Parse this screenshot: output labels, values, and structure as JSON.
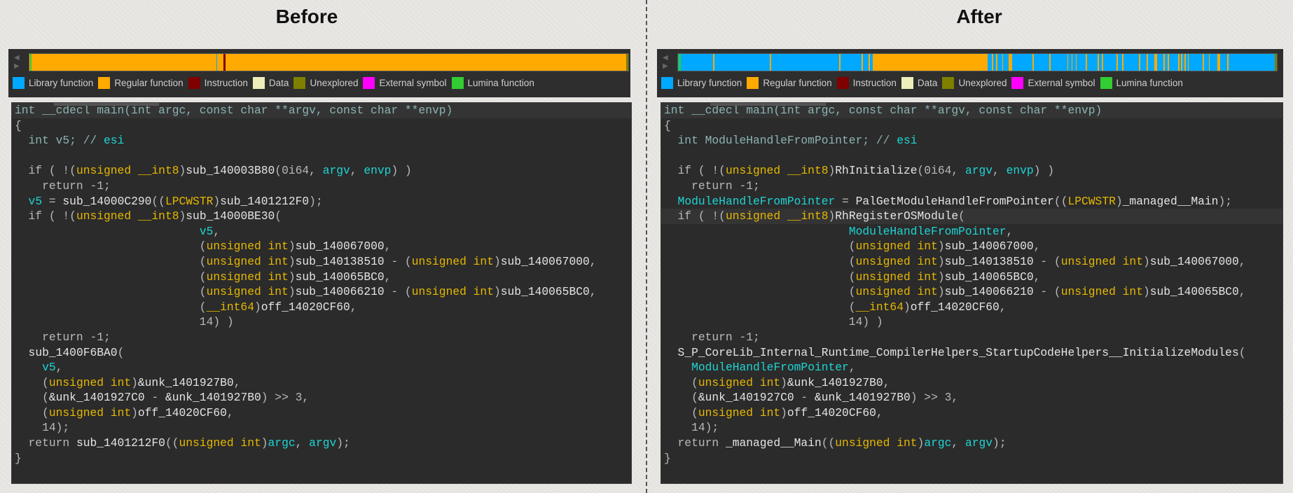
{
  "legend": [
    {
      "label": "Library function",
      "color": "#00a8ff"
    },
    {
      "label": "Regular function",
      "color": "#ffaa00"
    },
    {
      "label": "Instruction",
      "color": "#800000"
    },
    {
      "label": "Data",
      "color": "#eeeebb"
    },
    {
      "label": "Unexplored",
      "color": "#7f7f00"
    },
    {
      "label": "External symbol",
      "color": "#ff00ff"
    },
    {
      "label": "Lumina function",
      "color": "#33cc33"
    }
  ],
  "panels": [
    {
      "title": "Before",
      "bar_base": "#ffaa00",
      "bar_segments": [
        {
          "start": 0.001,
          "width": 0.003,
          "color": "#33cc33"
        },
        {
          "start": 0.312,
          "width": 0.002,
          "color": "#00a8ff"
        },
        {
          "start": 0.324,
          "width": 0.003,
          "color": "#800000"
        },
        {
          "start": 0.997,
          "width": 0.003,
          "color": "#7f7f00"
        }
      ],
      "highlighted_lines": [
        0
      ],
      "code": [
        [
          [
            "s",
            "int __cdecl main(int argc, const char **argv, const char **envp)"
          ]
        ],
        [
          [
            "k",
            "{"
          ]
        ],
        [
          [
            "s",
            "  int v5; // "
          ],
          [
            "v",
            "esi"
          ]
        ],
        [],
        [
          [
            "k",
            "  if ( !("
          ],
          [
            "t",
            "unsigned __int8"
          ],
          [
            "k",
            ")"
          ],
          [
            "i",
            "sub_140003B80"
          ],
          [
            "k",
            "(0i64, "
          ],
          [
            "v",
            "argv"
          ],
          [
            "k",
            ", "
          ],
          [
            "v",
            "envp"
          ],
          [
            "k",
            ") )"
          ]
        ],
        [
          [
            "k",
            "    return -1;"
          ]
        ],
        [
          [
            "k",
            "  "
          ],
          [
            "v",
            "v5"
          ],
          [
            "k",
            " = "
          ],
          [
            "i",
            "sub_14000C290"
          ],
          [
            "k",
            "(("
          ],
          [
            "t",
            "LPCWSTR"
          ],
          [
            "k",
            ")"
          ],
          [
            "i",
            "sub_1401212F0"
          ],
          [
            "k",
            ");"
          ]
        ],
        [
          [
            "k",
            "  if ( !("
          ],
          [
            "t",
            "unsigned __int8"
          ],
          [
            "k",
            ")"
          ],
          [
            "i",
            "sub_14000BE30"
          ],
          [
            "k",
            "("
          ]
        ],
        [
          [
            "k",
            "                           "
          ],
          [
            "v",
            "v5"
          ],
          [
            "k",
            ","
          ]
        ],
        [
          [
            "k",
            "                           ("
          ],
          [
            "t",
            "unsigned int"
          ],
          [
            "k",
            ")"
          ],
          [
            "i",
            "sub_140067000"
          ],
          [
            "k",
            ","
          ]
        ],
        [
          [
            "k",
            "                           ("
          ],
          [
            "t",
            "unsigned int"
          ],
          [
            "k",
            ")"
          ],
          [
            "i",
            "sub_140138510"
          ],
          [
            "k",
            " - ("
          ],
          [
            "t",
            "unsigned int"
          ],
          [
            "k",
            ")"
          ],
          [
            "i",
            "sub_140067000"
          ],
          [
            "k",
            ","
          ]
        ],
        [
          [
            "k",
            "                           ("
          ],
          [
            "t",
            "unsigned int"
          ],
          [
            "k",
            ")"
          ],
          [
            "i",
            "sub_140065BC0"
          ],
          [
            "k",
            ","
          ]
        ],
        [
          [
            "k",
            "                           ("
          ],
          [
            "t",
            "unsigned int"
          ],
          [
            "k",
            ")"
          ],
          [
            "i",
            "sub_140066210"
          ],
          [
            "k",
            " - ("
          ],
          [
            "t",
            "unsigned int"
          ],
          [
            "k",
            ")"
          ],
          [
            "i",
            "sub_140065BC0"
          ],
          [
            "k",
            ","
          ]
        ],
        [
          [
            "k",
            "                           ("
          ],
          [
            "t",
            "__int64"
          ],
          [
            "k",
            ")"
          ],
          [
            "i",
            "off_14020CF60"
          ],
          [
            "k",
            ","
          ]
        ],
        [
          [
            "k",
            "                           14) )"
          ]
        ],
        [
          [
            "k",
            "    return -1;"
          ]
        ],
        [
          [
            "k",
            "  "
          ],
          [
            "i",
            "sub_1400F6BA0"
          ],
          [
            "k",
            "("
          ]
        ],
        [
          [
            "k",
            "    "
          ],
          [
            "v",
            "v5"
          ],
          [
            "k",
            ","
          ]
        ],
        [
          [
            "k",
            "    ("
          ],
          [
            "t",
            "unsigned int"
          ],
          [
            "k",
            ")"
          ],
          [
            "i",
            "&unk_1401927B0"
          ],
          [
            "k",
            ","
          ]
        ],
        [
          [
            "k",
            "    ("
          ],
          [
            "i",
            "&unk_1401927C0"
          ],
          [
            "k",
            " - "
          ],
          [
            "i",
            "&unk_1401927B0"
          ],
          [
            "k",
            ") >> 3,"
          ]
        ],
        [
          [
            "k",
            "    ("
          ],
          [
            "t",
            "unsigned int"
          ],
          [
            "k",
            ")"
          ],
          [
            "i",
            "off_14020CF60"
          ],
          [
            "k",
            ","
          ]
        ],
        [
          [
            "k",
            "    14);"
          ]
        ],
        [
          [
            "k",
            "  return "
          ],
          [
            "i",
            "sub_1401212F0"
          ],
          [
            "k",
            "(("
          ],
          [
            "t",
            "unsigned int"
          ],
          [
            "k",
            ")"
          ],
          [
            "v",
            "argc"
          ],
          [
            "k",
            ", "
          ],
          [
            "v",
            "argv"
          ],
          [
            "k",
            ");"
          ]
        ],
        [
          [
            "k",
            "}"
          ]
        ]
      ]
    },
    {
      "title": "After",
      "bar_base": "#00a8ff",
      "bar_segments": [
        {
          "start": 0.001,
          "width": 0.004,
          "color": "#33cc33"
        },
        {
          "start": 0.325,
          "width": 0.192,
          "color": "#ffaa00"
        },
        {
          "start": 0.059,
          "width": 0.002,
          "color": "#ffaa00"
        },
        {
          "start": 0.153,
          "width": 0.002,
          "color": "#ffaa00"
        },
        {
          "start": 0.269,
          "width": 0.002,
          "color": "#ffaa00"
        },
        {
          "start": 0.307,
          "width": 0.002,
          "color": "#ffaa00"
        },
        {
          "start": 0.318,
          "width": 0.002,
          "color": "#ffaa00"
        },
        {
          "start": 0.524,
          "width": 0.002,
          "color": "#ffaa00"
        },
        {
          "start": 0.531,
          "width": 0.002,
          "color": "#ffaa00"
        },
        {
          "start": 0.541,
          "width": 0.002,
          "color": "#ffaa00"
        },
        {
          "start": 0.552,
          "width": 0.006,
          "color": "#ffaa00"
        },
        {
          "start": 0.592,
          "width": 0.002,
          "color": "#ffaa00"
        },
        {
          "start": 0.62,
          "width": 0.002,
          "color": "#ffaa00"
        },
        {
          "start": 0.65,
          "width": 0.002,
          "color": "#ffaa00"
        },
        {
          "start": 0.657,
          "width": 0.002,
          "color": "#ffaa00"
        },
        {
          "start": 0.664,
          "width": 0.002,
          "color": "#ffaa00"
        },
        {
          "start": 0.681,
          "width": 0.002,
          "color": "#ffaa00"
        },
        {
          "start": 0.701,
          "width": 0.002,
          "color": "#ffaa00"
        },
        {
          "start": 0.708,
          "width": 0.002,
          "color": "#ffaa00"
        },
        {
          "start": 0.732,
          "width": 0.002,
          "color": "#ffaa00"
        },
        {
          "start": 0.742,
          "width": 0.002,
          "color": "#ffaa00"
        },
        {
          "start": 0.77,
          "width": 0.002,
          "color": "#ffaa00"
        },
        {
          "start": 0.783,
          "width": 0.002,
          "color": "#ffaa00"
        },
        {
          "start": 0.795,
          "width": 0.005,
          "color": "#ffaa00"
        },
        {
          "start": 0.811,
          "width": 0.002,
          "color": "#ffaa00"
        },
        {
          "start": 0.818,
          "width": 0.002,
          "color": "#ffaa00"
        },
        {
          "start": 0.835,
          "width": 0.002,
          "color": "#ffaa00"
        },
        {
          "start": 0.84,
          "width": 0.002,
          "color": "#ffaa00"
        },
        {
          "start": 0.846,
          "width": 0.002,
          "color": "#ffaa00"
        },
        {
          "start": 0.851,
          "width": 0.002,
          "color": "#ffaa00"
        },
        {
          "start": 0.876,
          "width": 0.002,
          "color": "#ffaa00"
        },
        {
          "start": 0.886,
          "width": 0.002,
          "color": "#ffaa00"
        },
        {
          "start": 0.901,
          "width": 0.004,
          "color": "#ffaa00"
        },
        {
          "start": 0.917,
          "width": 0.002,
          "color": "#ffaa00"
        },
        {
          "start": 0.997,
          "width": 0.003,
          "color": "#7f7f00"
        }
      ],
      "highlighted_lines": [
        0,
        7
      ],
      "code": [
        [
          [
            "s",
            "int __cdecl main(int argc, const char **argv, const char **envp)"
          ]
        ],
        [
          [
            "k",
            "{"
          ]
        ],
        [
          [
            "s",
            "  int ModuleHandleFromPointer; // "
          ],
          [
            "v",
            "esi"
          ]
        ],
        [],
        [
          [
            "k",
            "  if ( !("
          ],
          [
            "t",
            "unsigned __int8"
          ],
          [
            "k",
            ")"
          ],
          [
            "i",
            "RhInitialize"
          ],
          [
            "k",
            "(0i64, "
          ],
          [
            "v",
            "argv"
          ],
          [
            "k",
            ", "
          ],
          [
            "v",
            "envp"
          ],
          [
            "k",
            ") )"
          ]
        ],
        [
          [
            "k",
            "    return -1;"
          ]
        ],
        [
          [
            "k",
            "  "
          ],
          [
            "v",
            "ModuleHandleFromPointer"
          ],
          [
            "k",
            " = "
          ],
          [
            "i",
            "PalGetModuleHandleFromPointer"
          ],
          [
            "k",
            "(("
          ],
          [
            "t",
            "LPCWSTR"
          ],
          [
            "k",
            ")"
          ],
          [
            "i",
            "_managed__Main"
          ],
          [
            "k",
            ");"
          ]
        ],
        [
          [
            "k",
            "  if ( !("
          ],
          [
            "t",
            "unsigned __int8"
          ],
          [
            "k",
            ")"
          ],
          [
            "i",
            "RhRegisterOSModule"
          ],
          [
            "k",
            "("
          ]
        ],
        [
          [
            "k",
            "                           "
          ],
          [
            "v",
            "ModuleHandleFromPointer"
          ],
          [
            "k",
            ","
          ]
        ],
        [
          [
            "k",
            "                           ("
          ],
          [
            "t",
            "unsigned int"
          ],
          [
            "k",
            ")"
          ],
          [
            "i",
            "sub_140067000"
          ],
          [
            "k",
            ","
          ]
        ],
        [
          [
            "k",
            "                           ("
          ],
          [
            "t",
            "unsigned int"
          ],
          [
            "k",
            ")"
          ],
          [
            "i",
            "sub_140138510"
          ],
          [
            "k",
            " - ("
          ],
          [
            "t",
            "unsigned int"
          ],
          [
            "k",
            ")"
          ],
          [
            "i",
            "sub_140067000"
          ],
          [
            "k",
            ","
          ]
        ],
        [
          [
            "k",
            "                           ("
          ],
          [
            "t",
            "unsigned int"
          ],
          [
            "k",
            ")"
          ],
          [
            "i",
            "sub_140065BC0"
          ],
          [
            "k",
            ","
          ]
        ],
        [
          [
            "k",
            "                           ("
          ],
          [
            "t",
            "unsigned int"
          ],
          [
            "k",
            ")"
          ],
          [
            "i",
            "sub_140066210"
          ],
          [
            "k",
            " - ("
          ],
          [
            "t",
            "unsigned int"
          ],
          [
            "k",
            ")"
          ],
          [
            "i",
            "sub_140065BC0"
          ],
          [
            "k",
            ","
          ]
        ],
        [
          [
            "k",
            "                           ("
          ],
          [
            "t",
            "__int64"
          ],
          [
            "k",
            ")"
          ],
          [
            "i",
            "off_14020CF60"
          ],
          [
            "k",
            ","
          ]
        ],
        [
          [
            "k",
            "                           14) )"
          ]
        ],
        [
          [
            "k",
            "    return -1;"
          ]
        ],
        [
          [
            "k",
            "  "
          ],
          [
            "i",
            "S_P_CoreLib_Internal_Runtime_CompilerHelpers_StartupCodeHelpers__InitializeModules"
          ],
          [
            "k",
            "("
          ]
        ],
        [
          [
            "k",
            "    "
          ],
          [
            "v",
            "ModuleHandleFromPointer"
          ],
          [
            "k",
            ","
          ]
        ],
        [
          [
            "k",
            "    ("
          ],
          [
            "t",
            "unsigned int"
          ],
          [
            "k",
            ")"
          ],
          [
            "i",
            "&unk_1401927B0"
          ],
          [
            "k",
            ","
          ]
        ],
        [
          [
            "k",
            "    ("
          ],
          [
            "i",
            "&unk_1401927C0"
          ],
          [
            "k",
            " - "
          ],
          [
            "i",
            "&unk_1401927B0"
          ],
          [
            "k",
            ") >> 3,"
          ]
        ],
        [
          [
            "k",
            "    ("
          ],
          [
            "t",
            "unsigned int"
          ],
          [
            "k",
            ")"
          ],
          [
            "i",
            "off_14020CF60"
          ],
          [
            "k",
            ","
          ]
        ],
        [
          [
            "k",
            "    14);"
          ]
        ],
        [
          [
            "k",
            "  return "
          ],
          [
            "i",
            "_managed__Main"
          ],
          [
            "k",
            "(("
          ],
          [
            "t",
            "unsigned int"
          ],
          [
            "k",
            ")"
          ],
          [
            "v",
            "argc"
          ],
          [
            "k",
            ", "
          ],
          [
            "v",
            "argv"
          ],
          [
            "k",
            ");"
          ]
        ],
        [
          [
            "k",
            "}"
          ]
        ]
      ]
    }
  ]
}
